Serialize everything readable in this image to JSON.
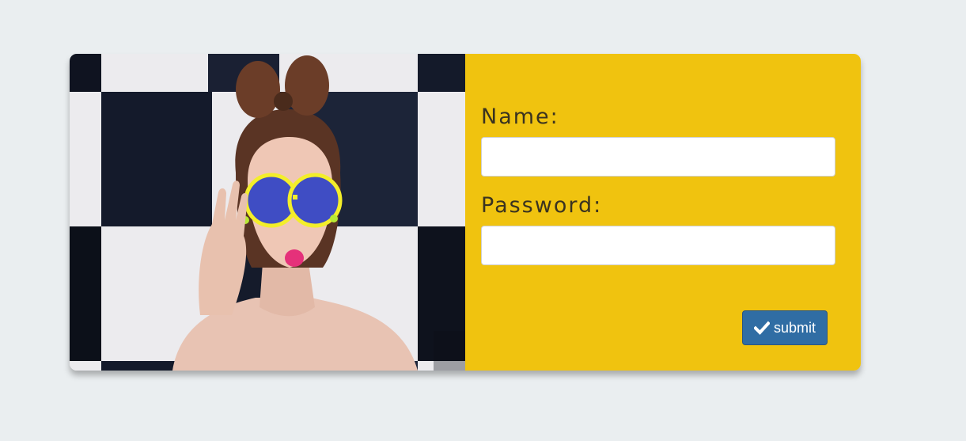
{
  "form": {
    "name_label": "Name:",
    "name_value": "",
    "password_label": "Password:",
    "password_value": "",
    "submit_label": "submit"
  },
  "icons": {
    "submit_icon": "check-icon"
  },
  "colors": {
    "page_background": "#eaeef0",
    "form_panel": "#f0c30f",
    "button": "#306da4",
    "label_text": "#3a3320"
  }
}
